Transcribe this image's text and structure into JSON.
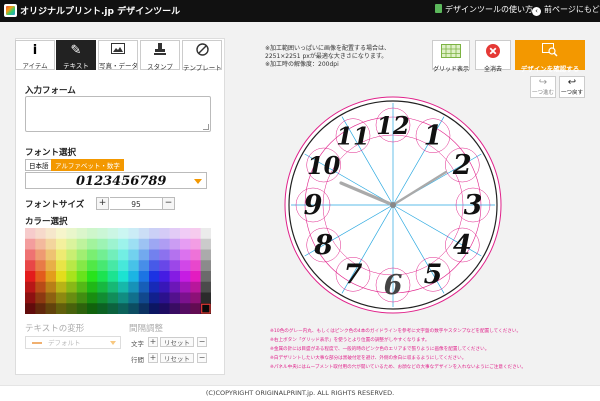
{
  "header": {
    "brand": "オリジナルプリント.jp デザインツール",
    "howto": "デザインツールの使い方",
    "back": "前ページにもどる"
  },
  "tabs": [
    {
      "label": "アイテム",
      "icon": "info-icon"
    },
    {
      "label": "テキスト",
      "icon": "pen-icon"
    },
    {
      "label": "写真・データ",
      "icon": "image-icon"
    },
    {
      "label": "スタンプ",
      "icon": "stamp-icon"
    },
    {
      "label": "テンプレート",
      "icon": "template-icon"
    }
  ],
  "text_panel": {
    "input_title": "入力フォーム",
    "font_title": "フォント選択",
    "font_tabs": [
      "日本語",
      "アルファベット・数字"
    ],
    "font_sample": "0123456789",
    "size_title": "フォントサイズ",
    "size_value": "95",
    "color_title": "カラー選択",
    "transform_title": "テキストの変形",
    "transform_value": "デフォルト",
    "spacing_title": "間隔調整",
    "spacing_rows": [
      {
        "label": "文字",
        "reset": "リセット"
      },
      {
        "label": "行間",
        "reset": "リセット"
      }
    ]
  },
  "canvas": {
    "notes": [
      "※加工範囲いっぱいに画像を配置する場合は、",
      "2251×2251 pxが最適な大きさになります。",
      "※加工時の解像度：200dpi"
    ],
    "clock_numbers": [
      "12",
      "1",
      "2",
      "3",
      "4",
      "5",
      "6",
      "7",
      "8",
      "9",
      "10",
      "11"
    ],
    "pink_notes": [
      "※10色のグレー内丸、もしくはピンク色の4本のガイドラインを参考に文字盤の数字やスタンプなどを配置してください。",
      "※右上ボタン「グリッド表示」を使うとより位置の調整がしやすくなります。",
      "※金属の針には目盛がある程度で、一般的時のピンク色のエリアまで張りように画像を配置してください。",
      "※白デザリントしたい大事な部分は黒破付近を避け、外側の余白に収まるようにしてください。",
      "※パネル中央にはムーブメント取付用の穴が開いているため、お顔などの大事なデザインを入れないようにご注意ください。"
    ]
  },
  "toolbar": {
    "grid": "グリッド表示",
    "clear": "全消去",
    "confirm": "デザインを確認する",
    "redo": "一つ進む",
    "undo": "一つ戻す"
  },
  "footer": {
    "copyright": "(C)COPYRIGHT ORIGINALPRINT.jp. ALL RIGHTS RESERVED."
  },
  "colors": {
    "accent": "#f39800",
    "header": "#111111",
    "guide_pink": "#e0218a",
    "guide_blue": "#29a8e0"
  }
}
